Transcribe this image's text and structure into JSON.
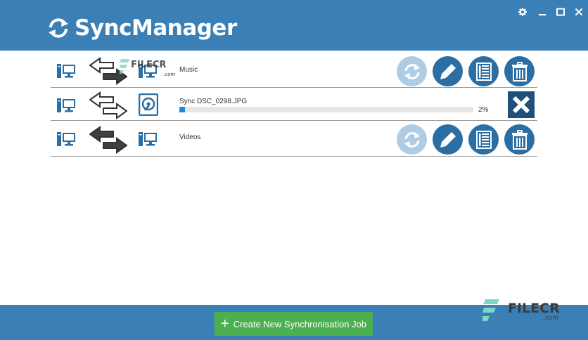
{
  "app": {
    "title": "SyncManager"
  },
  "window_controls": [
    {
      "icon": "gear-icon"
    },
    {
      "icon": "minimize-icon"
    },
    {
      "icon": "maximize-icon"
    },
    {
      "icon": "close-icon"
    }
  ],
  "jobs": [
    {
      "name": "Music",
      "source_icon": "computer-icon",
      "direction": "sync-arrows-outline",
      "target_icon": "computer-icon",
      "state": "idle"
    },
    {
      "status_text": "Sync DSC_0298.JPG",
      "progress_percent": 2,
      "progress_label": "2%",
      "source_icon": "computer-icon",
      "direction": "sync-arrows-outline",
      "target_icon": "hard-drive-icon",
      "state": "running"
    },
    {
      "name": "Videos",
      "source_icon": "computer-icon",
      "direction": "sync-arrows-filled",
      "target_icon": "computer-icon",
      "state": "idle"
    }
  ],
  "actions": {
    "sync": "sync-icon",
    "edit": "pencil-icon",
    "log": "log-list-icon",
    "delete": "trash-icon",
    "cancel": "cancel-x-icon"
  },
  "footer": {
    "create_label": "Create New Synchronisation Job",
    "create_icon": "plus-icon"
  },
  "watermark": {
    "brand": "FILECR",
    "domain": ".com"
  },
  "colors": {
    "header_bg": "#3a7fb6",
    "accent_blue": "#2b6ea3",
    "disabled_blue": "#aecde5",
    "progress": "#1e88e5",
    "create_button": "#4caf50",
    "cancel_button": "#1f4f7a"
  }
}
